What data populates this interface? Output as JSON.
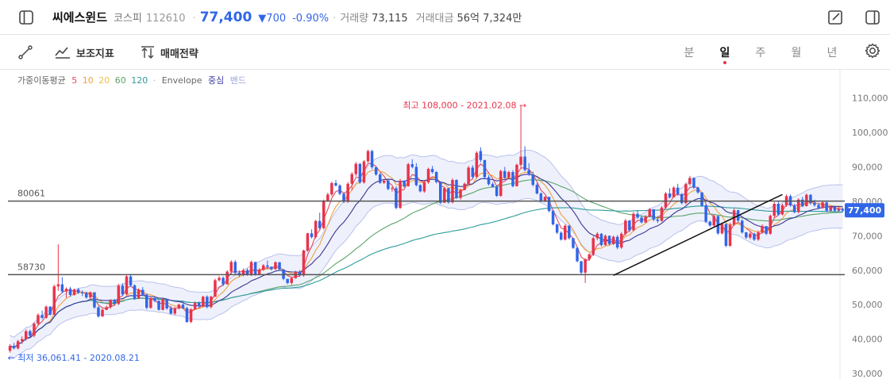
{
  "header": {
    "name": "씨에스윈드",
    "market": "코스피",
    "code": "112610",
    "price": "77,400",
    "change": "▼700",
    "rate": "-0.90%",
    "volume_label": "거래량",
    "volume": "73,115",
    "amount_label": "거래대금",
    "amount": "56억 7,324만"
  },
  "toolbar": {
    "indicators_label": "보조지표",
    "strategy_label": "매매전략",
    "periods": [
      "분",
      "일",
      "주",
      "월",
      "년"
    ],
    "active_period": "일"
  },
  "legend": {
    "ma_label": "가중이동평균",
    "ma_periods": [
      "5",
      "10",
      "20",
      "60",
      "120"
    ],
    "ma_colors": [
      "#e04a5c",
      "#f0a040",
      "#e8c24a",
      "#5aa36a",
      "#2e9c9c"
    ],
    "envelope_label": "Envelope",
    "center_label": "중심",
    "band_label": "밴드"
  },
  "colors": {
    "up": "#e8344c",
    "down": "#3166e8",
    "accent": "#3166e8",
    "envelope_fill": "#eef1fb",
    "envelope_line": "#b9c1ec",
    "center": "#3b3ba8"
  },
  "chart_data": {
    "type": "candlestick",
    "y_axis": {
      "min": 30000,
      "max": 115000,
      "ticks": [
        "110,000",
        "100,000",
        "90,000",
        "80,000",
        "70,000",
        "60,000",
        "50,000",
        "40,000",
        "30,000"
      ],
      "tick_values": [
        110000,
        100000,
        90000,
        80000,
        70000,
        60000,
        50000,
        40000,
        30000
      ]
    },
    "current_price": {
      "value": 77400,
      "label": "77,400"
    },
    "horizontal_lines": [
      {
        "value": 80061,
        "label": "80061"
      },
      {
        "value": 58730,
        "label": "58730"
      }
    ],
    "high_annotation": {
      "label": "최고 108,000 - 2021.02.08",
      "value": 108000,
      "index": 130
    },
    "low_annotation": {
      "label": "최저 36,061.41 - 2020.08.21",
      "value": 36061.41,
      "index": 0
    },
    "trendline": {
      "from": {
        "index": 150,
        "value": 58500
      },
      "to": {
        "index": 192,
        "value": 82000
      }
    },
    "candles": [
      [
        36600,
        38500,
        36061,
        38000
      ],
      [
        38000,
        38900,
        37000,
        37300
      ],
      [
        37300,
        39800,
        37000,
        39400
      ],
      [
        39400,
        40800,
        38600,
        40000
      ],
      [
        40000,
        42800,
        39500,
        42300
      ],
      [
        42300,
        42700,
        40600,
        41000
      ],
      [
        41000,
        44900,
        40500,
        44500
      ],
      [
        44500,
        47500,
        44000,
        47000
      ],
      [
        47000,
        48300,
        45800,
        46200
      ],
      [
        46200,
        49800,
        45900,
        49400
      ],
      [
        49400,
        49600,
        46800,
        47100
      ],
      [
        47100,
        55800,
        46900,
        55300
      ],
      [
        55300,
        67500,
        54000,
        55900
      ],
      [
        55900,
        58000,
        53300,
        53800
      ],
      [
        53800,
        55000,
        52000,
        54600
      ],
      [
        54600,
        55200,
        52300,
        52800
      ],
      [
        52800,
        54700,
        52600,
        54400
      ],
      [
        54400,
        54900,
        53100,
        53500
      ],
      [
        53500,
        54200,
        52500,
        53400
      ],
      [
        53400,
        53800,
        51700,
        52100
      ],
      [
        52100,
        53800,
        51300,
        53600
      ],
      [
        53600,
        53600,
        48800,
        49200
      ],
      [
        49200,
        49600,
        46200,
        46600
      ],
      [
        46600,
        48800,
        46400,
        48500
      ],
      [
        48500,
        49700,
        48400,
        49300
      ],
      [
        49300,
        51600,
        48800,
        51200
      ],
      [
        51200,
        51700,
        49900,
        50200
      ],
      [
        50200,
        56000,
        49900,
        55500
      ],
      [
        55500,
        56200,
        52600,
        53000
      ],
      [
        53000,
        58600,
        52800,
        58200
      ],
      [
        58200,
        58900,
        55200,
        55600
      ],
      [
        55600,
        55900,
        51400,
        51800
      ],
      [
        51800,
        54700,
        51600,
        54300
      ],
      [
        54300,
        55100,
        52500,
        52900
      ],
      [
        52900,
        53200,
        48600,
        49100
      ],
      [
        49100,
        52200,
        48800,
        51900
      ],
      [
        51900,
        52400,
        50700,
        51100
      ],
      [
        51100,
        51300,
        48300,
        48500
      ],
      [
        48500,
        51900,
        48300,
        51600
      ],
      [
        51600,
        51600,
        48500,
        48900
      ],
      [
        48900,
        49600,
        47100,
        47400
      ],
      [
        47400,
        49300,
        47000,
        48900
      ],
      [
        48900,
        50300,
        48600,
        50000
      ],
      [
        50000,
        51000,
        48700,
        49000
      ],
      [
        49000,
        49400,
        44700,
        45000
      ],
      [
        45000,
        49000,
        44600,
        48600
      ],
      [
        48600,
        50900,
        48500,
        50500
      ],
      [
        50500,
        50900,
        49100,
        49500
      ],
      [
        49500,
        52600,
        49200,
        52300
      ],
      [
        52300,
        52700,
        48900,
        49300
      ],
      [
        49300,
        52600,
        48900,
        52300
      ],
      [
        52300,
        57500,
        52200,
        57100
      ],
      [
        57100,
        58300,
        56700,
        57800
      ],
      [
        57800,
        58200,
        55400,
        55900
      ],
      [
        55900,
        60000,
        55800,
        59600
      ],
      [
        59600,
        62900,
        58600,
        62400
      ],
      [
        62400,
        62900,
        58700,
        59200
      ],
      [
        59200,
        60000,
        58100,
        58600
      ],
      [
        58600,
        60500,
        58200,
        60000
      ],
      [
        60000,
        60500,
        58400,
        58700
      ],
      [
        58700,
        62800,
        58300,
        62400
      ],
      [
        62400,
        62400,
        58400,
        58900
      ],
      [
        58900,
        60600,
        58600,
        60100
      ],
      [
        60100,
        61800,
        59800,
        61400
      ],
      [
        61400,
        62800,
        60400,
        61000
      ],
      [
        61000,
        61100,
        59900,
        60300
      ],
      [
        60300,
        62600,
        60100,
        62300
      ],
      [
        62300,
        62400,
        59900,
        60200
      ],
      [
        60200,
        60300,
        57100,
        57500
      ],
      [
        57500,
        57500,
        55900,
        56300
      ],
      [
        56300,
        58100,
        55700,
        57700
      ],
      [
        57700,
        59900,
        57500,
        59500
      ],
      [
        59500,
        60000,
        58200,
        58500
      ],
      [
        58500,
        66000,
        58100,
        65700
      ],
      [
        65700,
        70900,
        65400,
        70700
      ],
      [
        70700,
        71900,
        69200,
        69600
      ],
      [
        69600,
        74600,
        69200,
        74300
      ],
      [
        74300,
        76700,
        71800,
        72200
      ],
      [
        72200,
        80500,
        71800,
        80200
      ],
      [
        80200,
        82500,
        79900,
        82000
      ],
      [
        82000,
        85700,
        81500,
        85300
      ],
      [
        85300,
        86200,
        84300,
        84600
      ],
      [
        84600,
        85000,
        81800,
        82200
      ],
      [
        82200,
        82600,
        79500,
        79900
      ],
      [
        79900,
        85600,
        79500,
        85100
      ],
      [
        85100,
        88500,
        83200,
        87900
      ],
      [
        87900,
        91400,
        87200,
        90900
      ],
      [
        90900,
        91100,
        85100,
        85500
      ],
      [
        85500,
        92000,
        85100,
        91600
      ],
      [
        91600,
        95000,
        91300,
        94600
      ],
      [
        94600,
        95000,
        89400,
        89900
      ],
      [
        89900,
        90000,
        87400,
        87800
      ],
      [
        87800,
        88300,
        85100,
        85400
      ],
      [
        85400,
        86500,
        85000,
        86000
      ],
      [
        86000,
        86600,
        83200,
        83600
      ],
      [
        83600,
        84300,
        82800,
        83800
      ],
      [
        83800,
        84400,
        77700,
        78100
      ],
      [
        78100,
        86500,
        77800,
        86000
      ],
      [
        86000,
        86100,
        84000,
        84400
      ],
      [
        84400,
        91200,
        84300,
        90800
      ],
      [
        90800,
        92200,
        89600,
        90000
      ],
      [
        90000,
        91100,
        84300,
        84700
      ],
      [
        84700,
        85000,
        82600,
        82900
      ],
      [
        82900,
        85900,
        82500,
        85500
      ],
      [
        85500,
        89800,
        85100,
        89400
      ],
      [
        89400,
        90300,
        88100,
        88500
      ],
      [
        88500,
        88800,
        85200,
        85600
      ],
      [
        85600,
        85600,
        79200,
        79600
      ],
      [
        79600,
        84200,
        79500,
        83800
      ],
      [
        83800,
        83900,
        79300,
        79700
      ],
      [
        79700,
        86700,
        79400,
        86200
      ],
      [
        86200,
        86400,
        80700,
        81000
      ],
      [
        81000,
        83700,
        80500,
        83300
      ],
      [
        83300,
        85500,
        83200,
        85100
      ],
      [
        85100,
        90300,
        84800,
        89800
      ],
      [
        89800,
        90500,
        86700,
        87100
      ],
      [
        87100,
        94600,
        86700,
        94100
      ],
      [
        94600,
        95700,
        91400,
        92000
      ],
      [
        92000,
        92000,
        86600,
        87000
      ],
      [
        87000,
        87600,
        84600,
        85000
      ],
      [
        85000,
        85600,
        84000,
        84200
      ],
      [
        84200,
        84600,
        81300,
        81600
      ],
      [
        81600,
        89200,
        81300,
        88800
      ],
      [
        88800,
        90000,
        86500,
        86900
      ],
      [
        86900,
        88900,
        86500,
        88500
      ],
      [
        88500,
        89100,
        84100,
        84400
      ],
      [
        84400,
        91000,
        84300,
        90600
      ],
      [
        90600,
        108000,
        89500,
        93000
      ],
      [
        93000,
        96000,
        88700,
        89100
      ],
      [
        89100,
        91100,
        87400,
        87700
      ],
      [
        87700,
        88600,
        84300,
        84800
      ],
      [
        84800,
        85300,
        82000,
        82300
      ],
      [
        82300,
        82600,
        79800,
        80100
      ],
      [
        80100,
        81500,
        79800,
        81300
      ],
      [
        81300,
        81300,
        76800,
        77200
      ],
      [
        77200,
        77500,
        73000,
        73300
      ],
      [
        73300,
        73600,
        70500,
        70900
      ],
      [
        70900,
        71300,
        68600,
        68900
      ],
      [
        68900,
        73300,
        68600,
        72900
      ],
      [
        72900,
        73200,
        68900,
        69300
      ],
      [
        69300,
        69400,
        66200,
        66500
      ],
      [
        66500,
        66900,
        62300,
        62600
      ],
      [
        62600,
        62700,
        58900,
        59300
      ],
      [
        59300,
        63500,
        56300,
        63200
      ],
      [
        63200,
        64900,
        62700,
        64600
      ],
      [
        64600,
        69800,
        64100,
        69300
      ],
      [
        69300,
        71100,
        68700,
        70600
      ],
      [
        70600,
        70800,
        66900,
        67300
      ],
      [
        67300,
        70400,
        67100,
        70000
      ],
      [
        70000,
        70100,
        67200,
        67600
      ],
      [
        67600,
        70100,
        67300,
        69700
      ],
      [
        69700,
        70200,
        66100,
        66600
      ],
      [
        66600,
        71100,
        66200,
        70600
      ],
      [
        70600,
        74900,
        70100,
        74400
      ],
      [
        74400,
        74600,
        71100,
        71600
      ],
      [
        71600,
        76900,
        71300,
        76400
      ],
      [
        76400,
        77500,
        74900,
        75300
      ],
      [
        75300,
        75900,
        73600,
        73900
      ],
      [
        73900,
        76000,
        73700,
        75600
      ],
      [
        75600,
        78100,
        75500,
        77700
      ],
      [
        77700,
        77700,
        74200,
        74700
      ],
      [
        74700,
        75700,
        73700,
        74300
      ],
      [
        74300,
        78600,
        74100,
        78200
      ],
      [
        78200,
        82700,
        77900,
        82300
      ],
      [
        82300,
        83800,
        80800,
        81200
      ],
      [
        81200,
        84400,
        81100,
        84000
      ],
      [
        84000,
        85100,
        81600,
        82100
      ],
      [
        82100,
        82400,
        79100,
        79500
      ],
      [
        79500,
        85400,
        79100,
        85000
      ],
      [
        85000,
        87400,
        84600,
        86800
      ],
      [
        86800,
        87000,
        83600,
        84000
      ],
      [
        84000,
        84300,
        82200,
        82600
      ],
      [
        82600,
        82600,
        78400,
        78800
      ],
      [
        78800,
        79400,
        73700,
        74100
      ],
      [
        74100,
        74400,
        72600,
        73000
      ],
      [
        73000,
        76100,
        72700,
        75700
      ],
      [
        75700,
        75900,
        70300,
        70700
      ],
      [
        70700,
        73800,
        70400,
        73400
      ],
      [
        73400,
        73600,
        66700,
        67100
      ],
      [
        67100,
        73800,
        66800,
        73200
      ],
      [
        73200,
        77900,
        72900,
        77400
      ],
      [
        77400,
        77600,
        74000,
        74400
      ],
      [
        74400,
        74800,
        70600,
        71000
      ],
      [
        71000,
        71100,
        69100,
        69500
      ],
      [
        69500,
        71100,
        69000,
        70600
      ],
      [
        70600,
        70900,
        68500,
        68900
      ],
      [
        68900,
        71400,
        68500,
        71000
      ],
      [
        71000,
        73300,
        70600,
        72800
      ],
      [
        72800,
        72800,
        70200,
        70600
      ],
      [
        70600,
        76200,
        70300,
        75800
      ],
      [
        75800,
        79800,
        75300,
        79300
      ],
      [
        79300,
        80000,
        75800,
        76200
      ],
      [
        76200,
        79300,
        75900,
        78900
      ],
      [
        78900,
        82000,
        78400,
        81500
      ],
      [
        81500,
        82000,
        78400,
        78800
      ],
      [
        78800,
        79300,
        76500,
        76900
      ],
      [
        76900,
        80900,
        76500,
        80500
      ],
      [
        80500,
        81300,
        78300,
        78600
      ],
      [
        78600,
        82300,
        78500,
        81900
      ],
      [
        81900,
        82100,
        79000,
        79500
      ],
      [
        79500,
        80500,
        78400,
        78900
      ],
      [
        78900,
        79600,
        77700,
        78100
      ],
      [
        78100,
        80100,
        77800,
        79700
      ],
      [
        79700,
        79900,
        76900,
        77300
      ],
      [
        77300,
        78800,
        77000,
        78400
      ],
      [
        78400,
        78500,
        77000,
        77400
      ],
      [
        77400,
        78300,
        77000,
        77800
      ],
      [
        77800,
        78200,
        76900,
        77400
      ]
    ]
  }
}
